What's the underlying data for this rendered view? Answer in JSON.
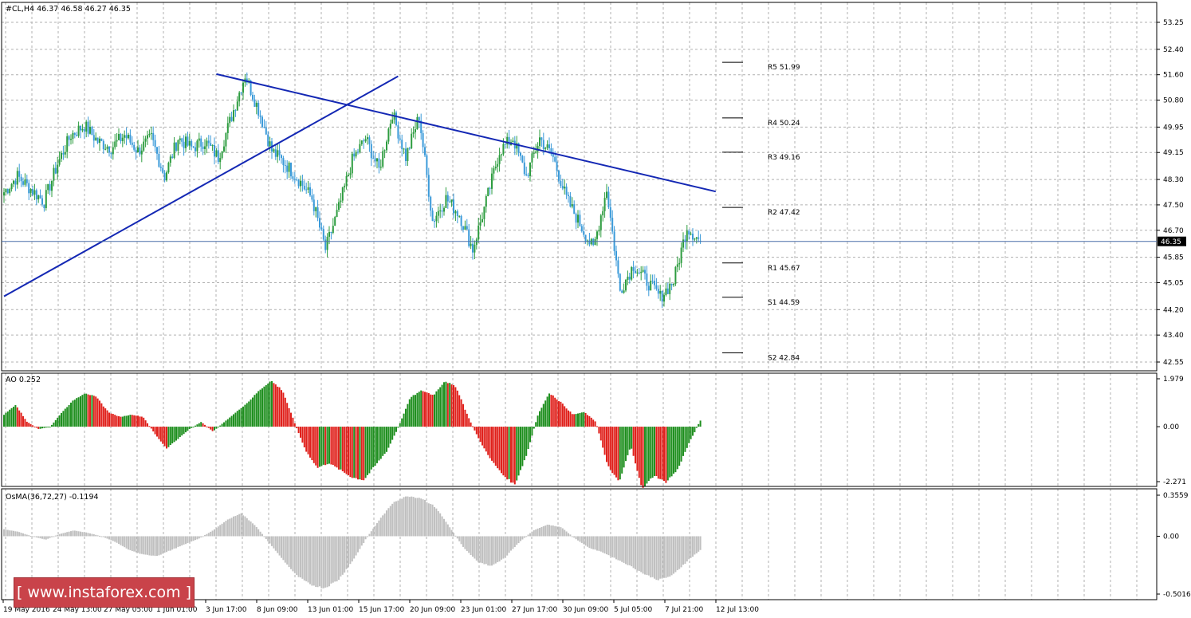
{
  "header": {
    "symbol_line": "#CL,H4  46.37 46.58 46.27 46.35",
    "ao_label": "AO 0.252",
    "osma_label": "OsMA(36,72,27) -0.1194"
  },
  "watermark": "[ www.instaforex.com ]",
  "colors": {
    "up_candle": "#2d9c3f",
    "down_candle": "#3a9ad9",
    "trendline": "#1428b4",
    "ao_up": "#1f8f1f",
    "ao_down": "#e0201b",
    "osma": "#c0c0c0",
    "grid": "#b0b0b0"
  },
  "chart_data": [
    {
      "type": "candlestick",
      "symbol": "#CL",
      "timeframe": "H4",
      "ohlc_current": {
        "open": 46.37,
        "high": 46.58,
        "low": 46.27,
        "close": 46.35
      },
      "last_price": "46.35",
      "ylim": [
        42.55,
        53.25
      ],
      "y_ticks": [
        "53.25",
        "52.40",
        "51.60",
        "50.80",
        "49.95",
        "49.15",
        "48.30",
        "47.50",
        "46.70",
        "45.85",
        "45.05",
        "44.20",
        "43.40",
        "42.55"
      ],
      "x_ticks": [
        "19 May 2016",
        "24 May 13:00",
        "27 May 05:00",
        "1 Jun 01:00",
        "3 Jun 17:00",
        "8 Jun 09:00",
        "13 Jun 01:00",
        "15 Jun 17:00",
        "20 Jun 09:00",
        "23 Jun 01:00",
        "27 Jun 17:00",
        "30 Jun 09:00",
        "5 Jul 05:00",
        "7 Jul 21:00",
        "12 Jul 13:00"
      ],
      "path_closes": [
        47.9,
        48.4,
        48.0,
        47.6,
        48.8,
        49.7,
        50.0,
        49.5,
        49.3,
        49.7,
        49.2,
        49.6,
        48.4,
        49.6,
        49.3,
        49.5,
        49.0,
        50.3,
        51.6,
        50.5,
        49.2,
        48.8,
        48.3,
        47.7,
        46.1,
        47.4,
        48.9,
        49.6,
        48.6,
        50.4,
        49.0,
        50.3,
        47.0,
        47.7,
        47.2,
        46.1,
        47.6,
        49.2,
        49.6,
        48.4,
        49.6,
        49.0,
        47.7,
        46.9,
        46.1,
        48.0,
        44.8,
        45.6,
        45.1,
        44.6,
        45.1,
        46.8,
        46.35
      ],
      "pivot_levels": [
        {
          "label": "R5 51.99",
          "value": 51.99
        },
        {
          "label": "R4 50.24",
          "value": 50.24
        },
        {
          "label": "R3 49.16",
          "value": 49.16
        },
        {
          "label": "R2 47.42",
          "value": 47.42
        },
        {
          "label": "R1 45.67",
          "value": 45.67
        },
        {
          "label": "S1 44.59",
          "value": 44.59
        },
        {
          "label": "S2 42.84",
          "value": 42.84
        }
      ],
      "trendlines": [
        {
          "name": "support",
          "from": {
            "bar": 0,
            "price": 44.62
          },
          "to": {
            "bar": 206,
            "price": 51.55
          }
        },
        {
          "name": "resistance",
          "from": {
            "bar": 111,
            "price": 51.62
          },
          "to": {
            "bar": 372,
            "price": 47.92
          }
        }
      ]
    },
    {
      "type": "bar",
      "name": "AO",
      "current_value": 0.252,
      "ylim": [
        -2.271,
        1.979
      ],
      "y_ticks": [
        "1.979",
        "0.00",
        "-2.271"
      ],
      "path": [
        0.5,
        0.9,
        0.2,
        -0.1,
        0.0,
        0.6,
        1.1,
        1.4,
        1.2,
        0.6,
        0.4,
        0.5,
        0.4,
        -0.3,
        -0.9,
        -0.5,
        -0.1,
        0.2,
        -0.2,
        0.2,
        0.6,
        1.0,
        1.5,
        1.9,
        1.5,
        0.2,
        -1.0,
        -1.7,
        -1.5,
        -1.8,
        -2.1,
        -2.2,
        -1.6,
        -1.0,
        0.0,
        1.2,
        1.5,
        1.3,
        1.9,
        1.6,
        0.4,
        -0.6,
        -1.4,
        -2.0,
        -2.4,
        -1.2,
        0.5,
        1.4,
        1.0,
        0.5,
        0.6,
        0.2,
        -1.6,
        -2.3,
        -0.8,
        -2.6,
        -2.0,
        -2.3,
        -1.8,
        -0.7,
        0.252
      ],
      "up_color": "#1f8f1f",
      "down_color": "#e0201b"
    },
    {
      "type": "bar",
      "name": "OsMA(36,72,27)",
      "current_value": -0.1194,
      "ylim": [
        -0.5016,
        0.3559
      ],
      "y_ticks": [
        "0.3559",
        "0.00",
        "-0.5016"
      ],
      "path": [
        0.06,
        0.04,
        0.0,
        -0.03,
        0.02,
        0.05,
        0.03,
        0.0,
        -0.05,
        -0.12,
        -0.16,
        -0.17,
        -0.12,
        -0.07,
        -0.02,
        0.05,
        0.14,
        0.2,
        0.1,
        -0.05,
        -0.2,
        -0.34,
        -0.42,
        -0.45,
        -0.38,
        -0.22,
        -0.02,
        0.15,
        0.3,
        0.35,
        0.33,
        0.25,
        0.08,
        -0.1,
        -0.22,
        -0.26,
        -0.18,
        -0.05,
        0.05,
        0.1,
        0.08,
        -0.02,
        -0.1,
        -0.14,
        -0.2,
        -0.26,
        -0.33,
        -0.38,
        -0.34,
        -0.22,
        -0.1194
      ],
      "color": "#c0c0c0"
    }
  ]
}
